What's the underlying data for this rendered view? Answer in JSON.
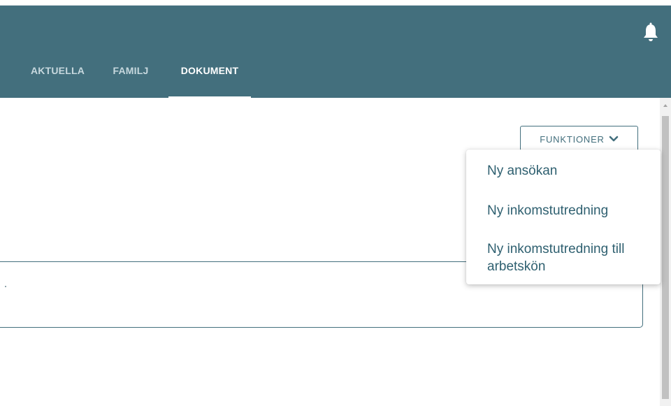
{
  "header": {
    "bell_icon": "bell-icon",
    "background": "#436f7d"
  },
  "tabs": [
    {
      "label": "AKTUELLA",
      "active": false
    },
    {
      "label": "FAMILJ",
      "active": false
    },
    {
      "label": "DOKUMENT",
      "active": true
    }
  ],
  "toolbar": {
    "functions_label": "FUNKTIONER",
    "functions_icon": "chevron-down-icon"
  },
  "dropdown": {
    "items": [
      {
        "label": "Ny ansökan"
      },
      {
        "label": "Ny inkomstutredning"
      },
      {
        "label": "Ny inkomstutredning till"
      },
      {
        "label": "arbetskön"
      }
    ]
  },
  "colors": {
    "accent": "#436f7d",
    "menu_text": "#2f6070"
  }
}
